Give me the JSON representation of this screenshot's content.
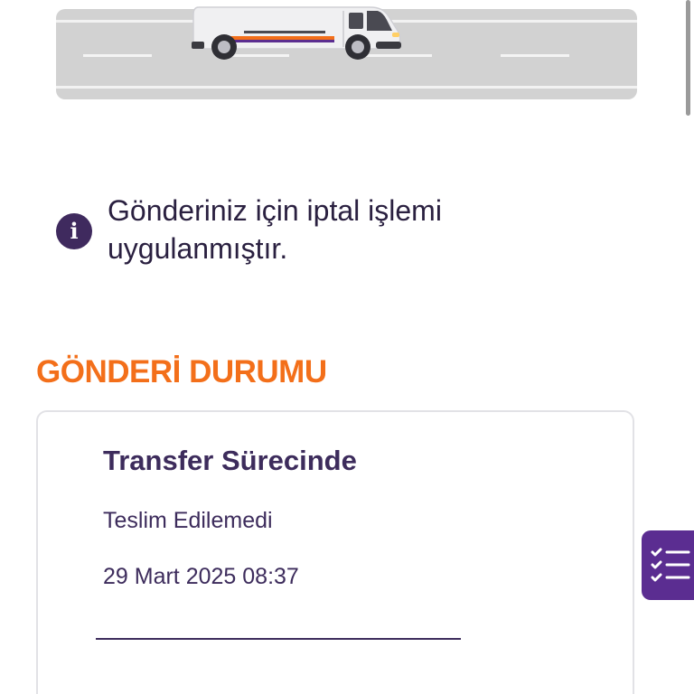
{
  "notice": {
    "icon": "info-icon",
    "text": "Gönderiniz için iptal işlemi uygulanmıştır."
  },
  "section": {
    "title": "GÖNDERİ DURUMU"
  },
  "status": {
    "title": "Transfer Sürecinde",
    "subtitle": "Teslim Edilemedi",
    "datetime": "29 Mart 2025 08:37"
  },
  "side_button": {
    "icon": "checklist-icon"
  },
  "colors": {
    "accent_orange": "#f36f1a",
    "brand_purple": "#5b2d91",
    "text_purple": "#3d2c5c"
  }
}
